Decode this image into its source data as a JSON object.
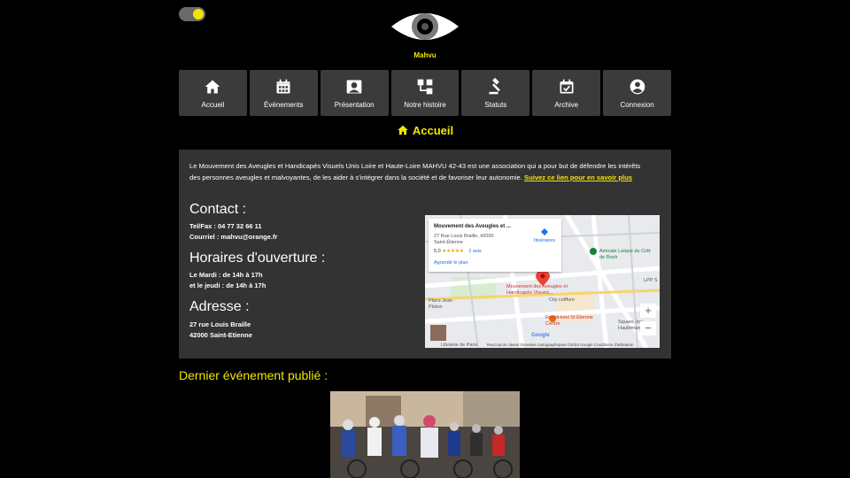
{
  "brand": {
    "name": "Mahvu"
  },
  "nav": [
    {
      "label": "Accueil",
      "icon": "home-icon"
    },
    {
      "label": "Événements",
      "icon": "calendar-icon"
    },
    {
      "label": "Présentation",
      "icon": "person-card-icon"
    },
    {
      "label": "Notre histoire",
      "icon": "sitemap-icon"
    },
    {
      "label": "Statuts",
      "icon": "gavel-icon"
    },
    {
      "label": "Archive",
      "icon": "calendar-check-icon"
    },
    {
      "label": "Connexion",
      "icon": "user-circle-icon"
    }
  ],
  "page": {
    "title": "Accueil"
  },
  "intro": {
    "text": "Le Mouvement des Aveugles et Handicapés Visuels Unis Loire et Haute-Loire MAHVU 42-43 est une association qui a pour but de défendre les intérêts des personnes aveugles et malvoyantes, de les aider à s'intégrer dans la société et de favoriser leur autonomie.",
    "link": "Suivez ce lien pour en savoir plus"
  },
  "contact": {
    "title": "Contact :",
    "phone": "Tel/Fax : 04 77 32 66 11",
    "email": "Courriel : mahvu@orange.fr"
  },
  "hours": {
    "title": "Horaires d'ouverture :",
    "line1": "Le Mardi : de 14h à 17h",
    "line2": "et le jeudi : de 14h à 17h"
  },
  "address": {
    "title": "Adresse :",
    "line1": "27 rue Louis Braille",
    "line2": "42000 Saint-Etienne"
  },
  "map": {
    "card_title": "Mouvement des Aveugles et ...",
    "card_address": "27 Rue Louis Braille, 42000 Saint-Étienne",
    "rating": "5,0",
    "stars": "★★★★★",
    "reviews": "2 avis",
    "enlarge": "Agrandir le plan",
    "itinerary": "Itinéraires",
    "pin_label": "Mouvement des Aveugles et Handicapés Visuels...",
    "place1": "Amicale Laïque du Crêt de Roch",
    "place2": "Place Jean Ploton",
    "place3": "City coiffure",
    "place4": "ResidHotel St Étienne Centre",
    "place5": "Square Jos Haubtmann",
    "place6": "LPP S",
    "place7": "Librairie de Paris",
    "zoom_in": "+",
    "zoom_out": "−",
    "footer": "Raccourcis clavier   Données cartographiques ©2024 Google   Conditions d'utilisation",
    "google": "Google"
  },
  "last_event": {
    "title": "Dernier événement publié :"
  },
  "colors": {
    "accent": "#f2e600",
    "panel": "#333333",
    "nav_bg": "#3b3b3b"
  }
}
